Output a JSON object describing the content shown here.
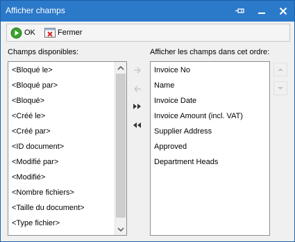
{
  "window": {
    "title": "Afficher champs"
  },
  "toolbar": {
    "ok_label": "OK",
    "close_label": "Fermer"
  },
  "left_panel": {
    "label": "Champs disponibles:",
    "items": [
      "<Bloqué le>",
      "<Bloqué par>",
      "<Bloqué>",
      "<Créé le>",
      "<Créé par>",
      "<ID document>",
      "<Modifié par>",
      "<Modifié>",
      "<Nombre fichiers>",
      "<Taille du document>",
      "<Type fichier>"
    ]
  },
  "right_panel": {
    "label": "Afficher les champs dans cet ordre:",
    "items": [
      "Invoice No",
      "Name",
      "Invoice Date",
      "Invoice Amount (incl. VAT)",
      "Supplier Address",
      "Approved",
      "Department Heads"
    ]
  },
  "icons": {
    "pin": "pin-icon",
    "minimize": "minimize-icon",
    "close": "close-icon",
    "ok": "ok-play-icon",
    "fermer": "close-window-icon",
    "add": "arrow-right-icon",
    "remove": "arrow-left-icon",
    "add_all": "double-arrow-right-icon",
    "remove_all": "double-arrow-left-icon",
    "move_up": "move-up-icon",
    "move_down": "move-down-icon"
  },
  "colors": {
    "titlebar": "#2b79c9",
    "ok_green": "#3aa12e",
    "fermer_red": "#d62020"
  }
}
